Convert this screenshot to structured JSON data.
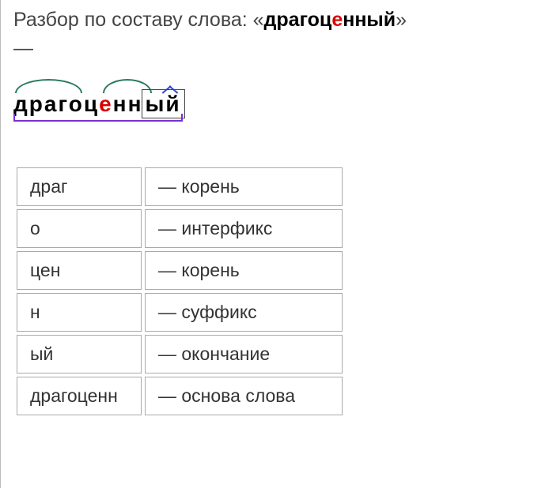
{
  "title_prefix": "Разбор по составу слова: «",
  "title_word_pre": "драгоц",
  "title_word_stress": "е",
  "title_word_post": "нный",
  "title_suffix": "»",
  "dash": "—",
  "diagram": {
    "p1": "драг",
    "p2": "о",
    "p3": "ц",
    "p4_stress": "е",
    "p5": "н",
    "p6": "н",
    "p7_ending": "ый"
  },
  "morphs": [
    {
      "part": "драг",
      "label": "— корень"
    },
    {
      "part": "о",
      "label": "— интерфикс"
    },
    {
      "part": "цен",
      "label": "— корень"
    },
    {
      "part": "н",
      "label": "— суффикс"
    },
    {
      "part": "ый",
      "label": "— окончание"
    },
    {
      "part": "драгоценн",
      "label": "— основа слова"
    }
  ]
}
